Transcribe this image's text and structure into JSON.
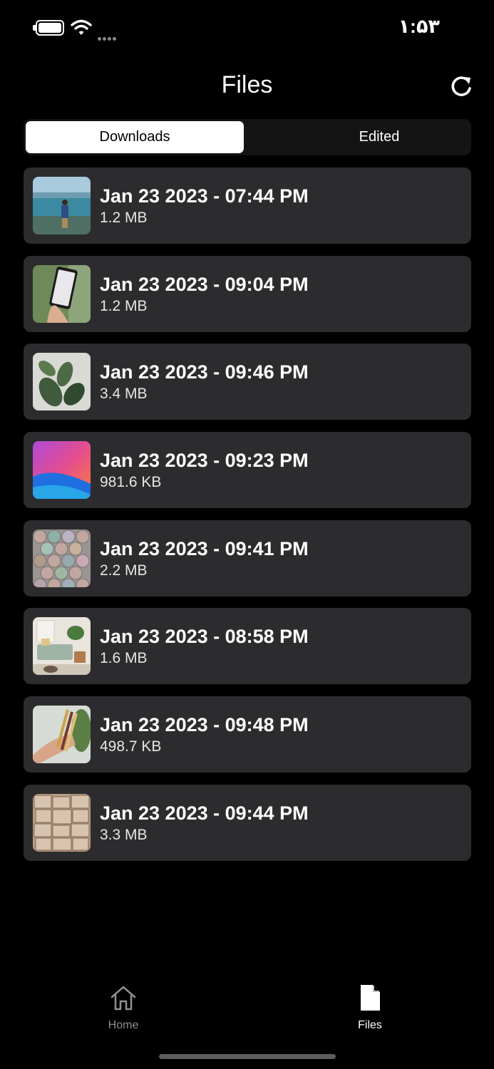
{
  "status_bar": {
    "time": "۱:۵۳"
  },
  "header": {
    "title": "Files",
    "refresh_icon": "refresh-icon"
  },
  "segmented_control": {
    "tabs": [
      {
        "label": "Downloads",
        "selected": true
      },
      {
        "label": "Edited",
        "selected": false
      }
    ]
  },
  "files": [
    {
      "title": "Jan 23 2023 - 07:44 PM",
      "size": "1.2 MB",
      "thumb": "beach-photo"
    },
    {
      "title": "Jan 23 2023 - 09:04 PM",
      "size": "1.2 MB",
      "thumb": "phone-map-photo"
    },
    {
      "title": "Jan 23 2023 - 09:46 PM",
      "size": "3.4 MB",
      "thumb": "plant-leaves-photo"
    },
    {
      "title": "Jan 23 2023 - 09:23 PM",
      "size": "981.6 KB",
      "thumb": "gradient-wallpaper"
    },
    {
      "title": "Jan 23 2023 - 09:41 PM",
      "size": "2.2 MB",
      "thumb": "tiles-pattern-photo"
    },
    {
      "title": "Jan 23 2023 - 08:58 PM",
      "size": "1.6 MB",
      "thumb": "living-room-photo"
    },
    {
      "title": "Jan 23 2023 - 09:48 PM",
      "size": "498.7 KB",
      "thumb": "hand-pencils-photo"
    },
    {
      "title": "Jan 23 2023 - 09:44 PM",
      "size": "3.3 MB",
      "thumb": "book-pages-photo"
    }
  ],
  "tab_bar": {
    "items": [
      {
        "label": "Home",
        "icon": "home-icon",
        "active": false
      },
      {
        "label": "Files",
        "icon": "file-icon",
        "active": true
      }
    ]
  },
  "colors": {
    "background": "#000000",
    "card": "#2c2c2e",
    "segment_bg": "#141414",
    "inactive_tab": "#8e8e93"
  }
}
